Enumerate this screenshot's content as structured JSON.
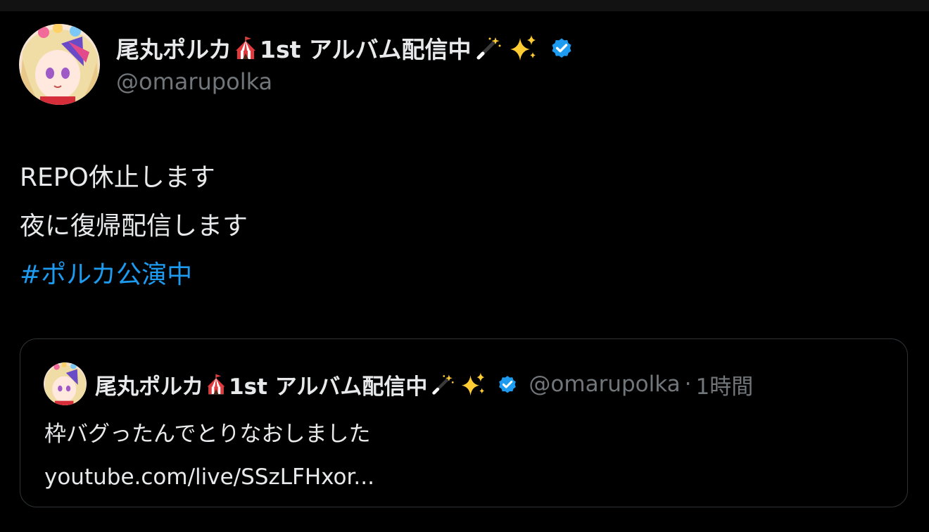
{
  "author": {
    "display_name": "尾丸ポルカ",
    "name_suffix": "1st アルバム配信中",
    "handle": "@omarupolka",
    "emojis": [
      "circus-tent-icon",
      "magic-wand-icon",
      "sparkles-icon"
    ],
    "verified_icon": "verified-badge-icon"
  },
  "tweet": {
    "lines": [
      "REPO休止します",
      "夜に復帰配信します"
    ],
    "hashtag": "#ポルカ公演中"
  },
  "quote": {
    "display_name": "尾丸ポルカ",
    "name_suffix": "1st アルバム配信中",
    "handle": "@omarupolka",
    "separator": "·",
    "time": "1時間",
    "lines": [
      "枠バグったんでとりなおしました",
      "youtube.com/live/SSzLFHxor..."
    ]
  },
  "colors": {
    "background": "#000000",
    "text": "#e7e9ea",
    "muted": "#71767b",
    "accent": "#1d9bf0",
    "border": "#2f3336"
  }
}
